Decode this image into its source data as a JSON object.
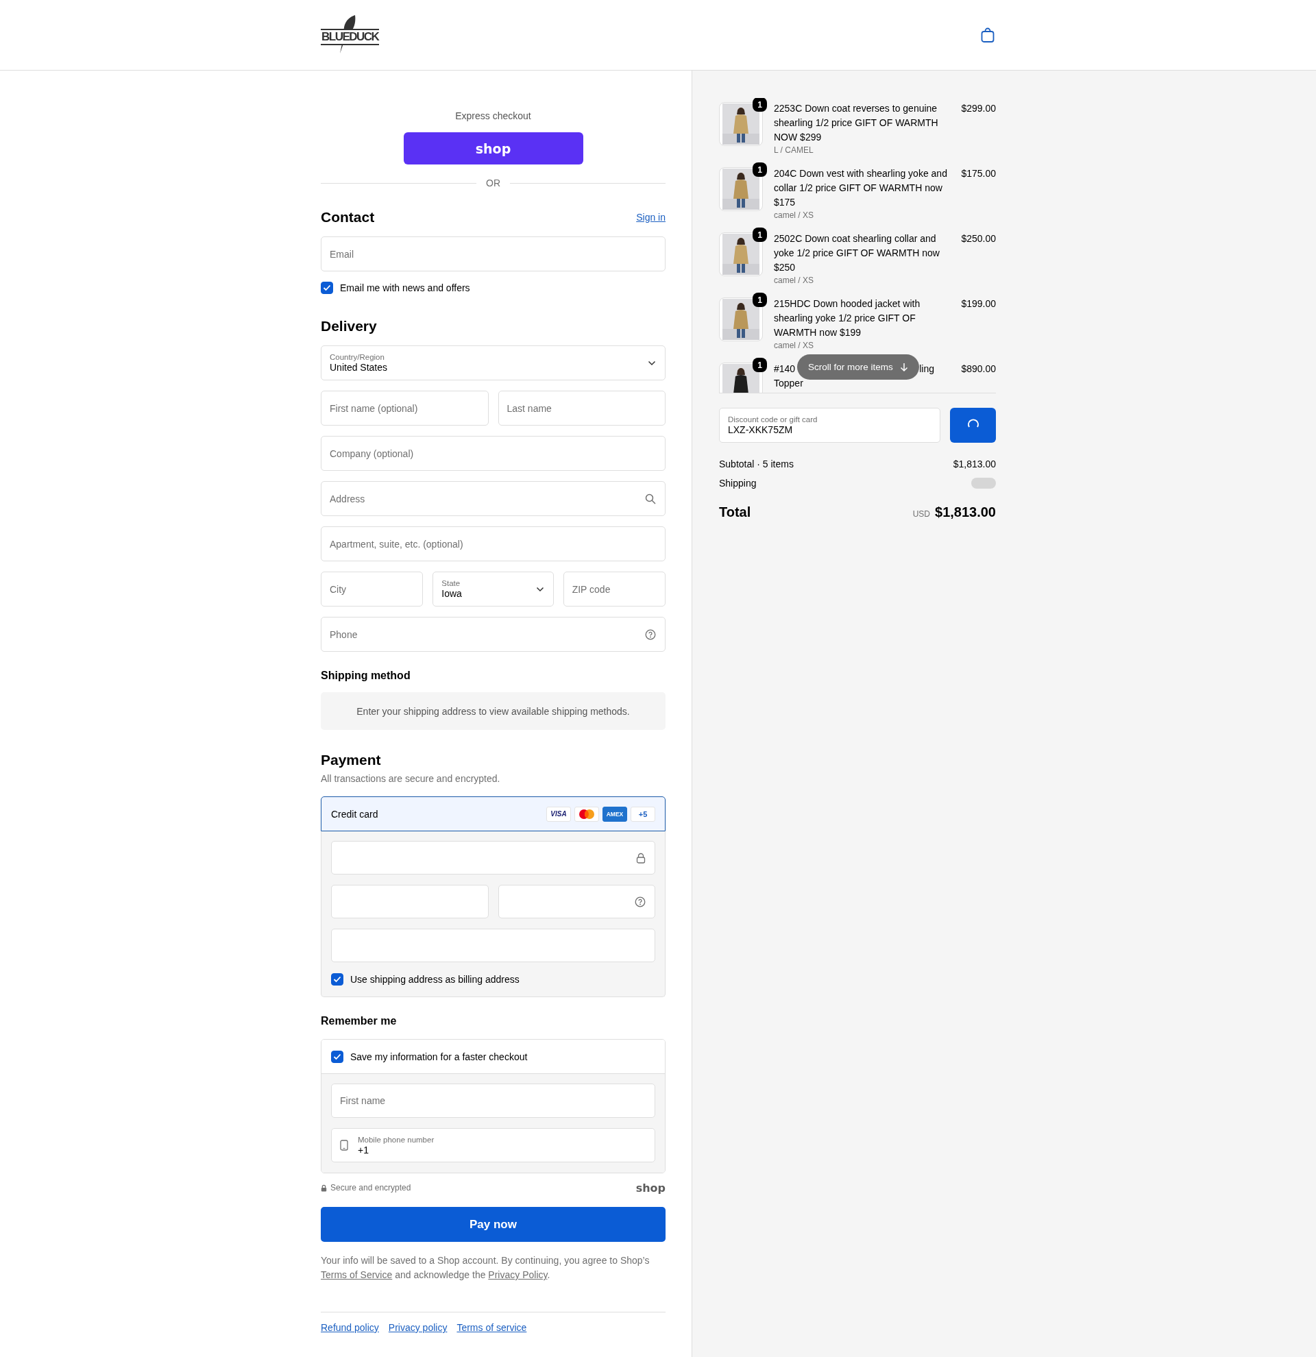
{
  "header": {
    "logo": "BLUEDUCK"
  },
  "express": {
    "title": "Express checkout",
    "shop_button": "shop",
    "divider": "OR"
  },
  "contact": {
    "heading": "Contact",
    "sign_in": "Sign in",
    "email": {
      "kind": "text",
      "placeholder": "Email"
    },
    "newsletter": {
      "label": "Email me with news and offers",
      "checked": true
    }
  },
  "delivery": {
    "heading": "Delivery",
    "rows": [
      [
        {
          "kind": "select",
          "label": "Country/Region",
          "value": "United States"
        }
      ],
      [
        {
          "kind": "text",
          "placeholder": "First name (optional)"
        },
        {
          "kind": "text",
          "placeholder": "Last name"
        }
      ],
      [
        {
          "kind": "text",
          "placeholder": "Company (optional)"
        }
      ],
      [
        {
          "kind": "text",
          "placeholder": "Address"
        }
      ],
      [
        {
          "kind": "text",
          "placeholder": "Apartment, suite, etc. (optional)"
        }
      ],
      [
        {
          "kind": "text",
          "placeholder": "City"
        },
        {
          "kind": "select",
          "label": "State",
          "value": "Iowa"
        },
        {
          "kind": "text",
          "placeholder": "ZIP code"
        }
      ],
      [
        {
          "kind": "text",
          "placeholder": "Phone"
        }
      ]
    ]
  },
  "shipping_method": {
    "heading": "Shipping method",
    "notice": "Enter your shipping address to view available shipping methods."
  },
  "payment": {
    "heading": "Payment",
    "subtitle": "All transactions are secure and encrypted.",
    "methods": [
      {
        "label": "Credit card",
        "selected": true,
        "cards": [
          {
            "kind": "visa",
            "text": "VISA"
          },
          {
            "kind": "mastercard"
          },
          {
            "kind": "amex",
            "text": "AMEX"
          },
          {
            "kind": "more",
            "text": "+5"
          }
        ]
      }
    ],
    "card_rows": [
      [
        {
          "kind": "blank"
        }
      ],
      [
        {
          "kind": "blank"
        },
        {
          "kind": "blank"
        }
      ],
      [
        {
          "kind": "blank"
        }
      ]
    ],
    "billing": {
      "label": "Use shipping address as billing address",
      "checked": true
    }
  },
  "remember": {
    "heading": "Remember me",
    "save": {
      "label": "Save my information for a faster checkout",
      "checked": true
    },
    "rows": [
      [
        {
          "kind": "text",
          "placeholder": "First name"
        }
      ],
      [
        {
          "kind": "floating",
          "label": "Mobile phone number",
          "value": "+1"
        }
      ]
    ],
    "secure": "Secure and encrypted",
    "brand": "shop"
  },
  "pay_button": "Pay now",
  "legal": [
    {
      "kind": "text",
      "text": "Your info will be saved to a Shop account. By continuing, you agree to Shop’s "
    },
    {
      "kind": "link",
      "text": "Terms of Service"
    },
    {
      "kind": "text",
      "text": " and acknowledge the "
    },
    {
      "kind": "link",
      "text": "Privacy Policy"
    },
    {
      "kind": "text",
      "text": "."
    }
  ],
  "footer_links": [
    "Refund policy",
    "Privacy policy",
    "Terms of service"
  ],
  "summary": {
    "items": [
      {
        "kind": "full",
        "quantity": "1",
        "name": "2253C Down coat reverses to genuine shearling 1/2 price GIFT OF WARMTH NOW $299",
        "variant": "L / CAMEL",
        "price": "$299.00"
      },
      {
        "kind": "full",
        "quantity": "1",
        "name": "204C Down vest with shearling yoke and collar 1/2 price GIFT OF WARMTH now $175",
        "variant": "camel / XS",
        "price": "$175.00"
      },
      {
        "kind": "full",
        "quantity": "1",
        "name": "2502C Down coat shearling collar and yoke 1/2 price GIFT OF WARMTH now $250",
        "variant": "camel / XS",
        "price": "$250.00"
      },
      {
        "kind": "full",
        "quantity": "1",
        "name": "215HDC Down hooded jacket with shearling yoke 1/2 price GIFT OF WARMTH now $199",
        "variant": "camel / XS",
        "price": "$199.00"
      },
      {
        "kind": "partly_hidden",
        "quantity": "1",
        "name_lines": [
          [
            "#140",
            "ling"
          ],
          [
            "Topper"
          ]
        ],
        "price": "$890.00"
      }
    ],
    "scroll_hint": "Scroll for more items",
    "discount": {
      "label": "Discount code or gift card",
      "value": "LXZ-XKK75ZM",
      "loading": true
    },
    "subtotal": {
      "label": "Subtotal · 5 items",
      "value": "$1,813.00"
    },
    "shipping": {
      "label": "Shipping",
      "loading": true
    },
    "total": {
      "label": "Total",
      "currency": "USD",
      "value": "$1,813.00"
    }
  }
}
